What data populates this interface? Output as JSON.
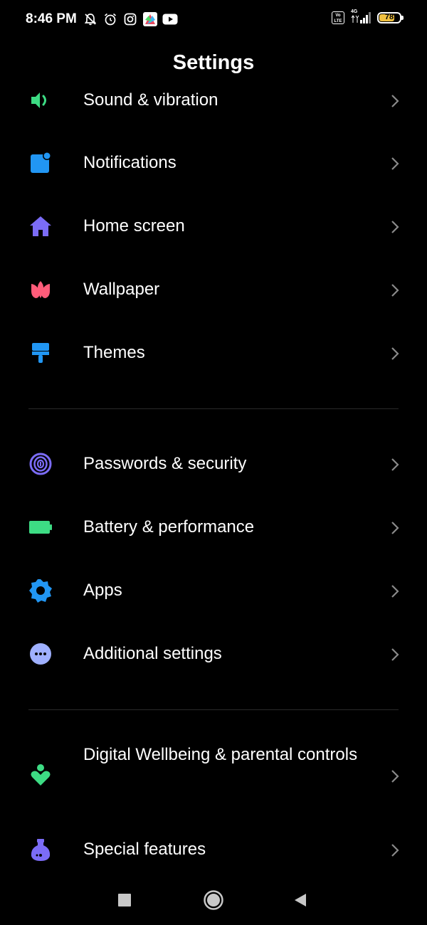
{
  "status_bar": {
    "time": "8:46 PM",
    "left_icons": [
      "bell-off-icon",
      "alarm-icon",
      "instagram-icon",
      "app-icon",
      "youtube-icon"
    ],
    "volte": "Vo LTE",
    "network": "4G",
    "battery": "78",
    "battery_level": 0.78
  },
  "header": {
    "title": "Settings"
  },
  "sections": [
    {
      "items": [
        {
          "label": "Sound & vibration",
          "icon": "sound-icon",
          "color": "#3ddc84"
        },
        {
          "label": "Notifications",
          "icon": "notifications-icon",
          "color": "#2196f3"
        },
        {
          "label": "Home screen",
          "icon": "home-icon",
          "color": "#7b6cf6"
        },
        {
          "label": "Wallpaper",
          "icon": "wallpaper-icon",
          "color": "#ff5c7a"
        },
        {
          "label": "Themes",
          "icon": "themes-icon",
          "color": "#2196f3"
        }
      ]
    },
    {
      "items": [
        {
          "label": "Passwords & security",
          "icon": "fingerprint-icon",
          "color": "#7b6cf6"
        },
        {
          "label": "Battery & performance",
          "icon": "battery-icon",
          "color": "#3ddc84"
        },
        {
          "label": "Apps",
          "icon": "gear-icon",
          "color": "#2196f3"
        },
        {
          "label": "Additional settings",
          "icon": "more-icon",
          "color": "#9fb0ff"
        }
      ]
    },
    {
      "items": [
        {
          "label": "Digital Wellbeing & parental controls",
          "icon": "wellbeing-icon",
          "color": "#3ddc84"
        },
        {
          "label": "Special features",
          "icon": "special-features-icon",
          "color": "#7b6cf6"
        }
      ]
    }
  ],
  "nav_bar": {
    "buttons": [
      "recents-button",
      "home-button",
      "back-button"
    ]
  }
}
